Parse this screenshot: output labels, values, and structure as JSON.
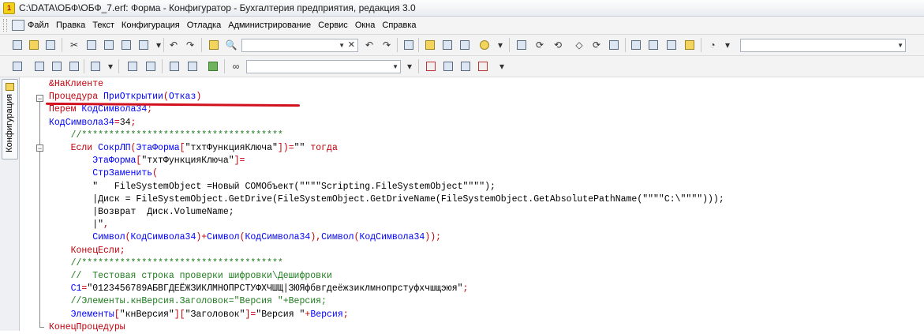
{
  "window": {
    "title": "C:\\DATA\\ОБФ\\ОБФ_7.erf: Форма - Конфигуратор - Бухгалтерия предприятия, редакция 3.0"
  },
  "menu": {
    "items": [
      {
        "label": "Файл"
      },
      {
        "label": "Правка"
      },
      {
        "label": "Текст"
      },
      {
        "label": "Конфигурация"
      },
      {
        "label": "Отладка"
      },
      {
        "label": "Администрирование"
      },
      {
        "label": "Сервис"
      },
      {
        "label": "Окна"
      },
      {
        "label": "Справка"
      }
    ]
  },
  "toolbar": {
    "search_value": "",
    "combo2_value": "",
    "combo3_value": "",
    "combo4_value": ""
  },
  "sidebar": {
    "tab_label": "Конфигурация"
  },
  "code": {
    "lines": [
      [
        {
          "t": "&НаКлиенте",
          "c": "op"
        }
      ],
      [
        {
          "t": "Процедура ",
          "c": "kw"
        },
        {
          "t": "ПриОткрытии",
          "c": "id"
        },
        {
          "t": "(",
          "c": "op"
        },
        {
          "t": "Отказ",
          "c": "id"
        },
        {
          "t": ")",
          "c": "op"
        }
      ],
      [
        {
          "t": "Перем ",
          "c": "kw"
        },
        {
          "t": "КодСимвола34",
          "c": "id"
        },
        {
          "t": ";",
          "c": "op"
        }
      ],
      [
        {
          "t": "КодСимвола34",
          "c": "id"
        },
        {
          "t": "=",
          "c": "op"
        },
        {
          "t": "34",
          "c": "str"
        },
        {
          "t": ";",
          "c": "op"
        }
      ],
      [
        {
          "t": "    //*************************************",
          "c": "cmt"
        }
      ],
      [
        {
          "t": "    Если ",
          "c": "kw"
        },
        {
          "t": "СокрЛП",
          "c": "id"
        },
        {
          "t": "(",
          "c": "op"
        },
        {
          "t": "ЭтаФорма",
          "c": "id"
        },
        {
          "t": "[",
          "c": "op"
        },
        {
          "t": "\"тхтФункцияКлюча\"",
          "c": "str"
        },
        {
          "t": "])=",
          "c": "op"
        },
        {
          "t": "\"\"",
          "c": "str"
        },
        {
          "t": " тогда",
          "c": "kw"
        }
      ],
      [
        {
          "t": "        ЭтаФорма",
          "c": "id"
        },
        {
          "t": "[",
          "c": "op"
        },
        {
          "t": "\"тхтФункцияКлюча\"",
          "c": "str"
        },
        {
          "t": "]=",
          "c": "op"
        }
      ],
      [
        {
          "t": "        СтрЗаменить",
          "c": "id"
        },
        {
          "t": "(",
          "c": "op"
        }
      ],
      [
        {
          "t": "        \"   FileSystemObject =Новый COMОбъект(\"\"\"\"Scripting.FileSystemObject\"\"\"\");",
          "c": "str"
        }
      ],
      [
        {
          "t": "        |Диск = FileSystemObject.GetDrive(FileSystemObject.GetDriveName(FileSystemObject.GetAbsolutePathName(\"\"\"\"C:\\\"\"\"\")));",
          "c": "str"
        }
      ],
      [
        {
          "t": "        |Возврат  Диск.VolumeName;",
          "c": "str"
        }
      ],
      [
        {
          "t": "        |\"",
          "c": "str"
        },
        {
          "t": ",",
          "c": "op"
        }
      ],
      [
        {
          "t": "        Символ",
          "c": "id"
        },
        {
          "t": "(",
          "c": "op"
        },
        {
          "t": "КодСимвола34",
          "c": "id"
        },
        {
          "t": ")+",
          "c": "op"
        },
        {
          "t": "Символ",
          "c": "id"
        },
        {
          "t": "(",
          "c": "op"
        },
        {
          "t": "КодСимвола34",
          "c": "id"
        },
        {
          "t": "),",
          "c": "op"
        },
        {
          "t": "Символ",
          "c": "id"
        },
        {
          "t": "(",
          "c": "op"
        },
        {
          "t": "КодСимвола34",
          "c": "id"
        },
        {
          "t": "));",
          "c": "op"
        }
      ],
      [
        {
          "t": "    КонецЕсли",
          "c": "kw"
        },
        {
          "t": ";",
          "c": "op"
        }
      ],
      [
        {
          "t": "    //*************************************",
          "c": "cmt"
        }
      ],
      [
        {
          "t": "    //  Тестовая строка проверки шифровки\\Дешифровки",
          "c": "cmt"
        }
      ],
      [
        {
          "t": "    С1",
          "c": "id"
        },
        {
          "t": "=",
          "c": "op"
        },
        {
          "t": "\"0123456789АБВГДЕЁЖЗИКЛМНОПРСТУФХЧШЩ|ЗЮЯфбвгдеёжзиклмнопрстуфхчшщэюя\"",
          "c": "str"
        },
        {
          "t": ";",
          "c": "op"
        }
      ],
      [
        {
          "t": "    //Элементы.кнВерсия.Заголовок=\"Версия \"+Версия;",
          "c": "cmt"
        }
      ],
      [
        {
          "t": "    Элементы",
          "c": "id"
        },
        {
          "t": "[",
          "c": "op"
        },
        {
          "t": "\"кнВерсия\"",
          "c": "str"
        },
        {
          "t": "][",
          "c": "op"
        },
        {
          "t": "\"Заголовок\"",
          "c": "str"
        },
        {
          "t": "]=",
          "c": "op"
        },
        {
          "t": "\"Версия \"",
          "c": "str"
        },
        {
          "t": "+",
          "c": "op"
        },
        {
          "t": "Версия",
          "c": "id"
        },
        {
          "t": ";",
          "c": "op"
        }
      ],
      [
        {
          "t": "КонецПроцедуры",
          "c": "kw"
        }
      ]
    ]
  },
  "colors": {
    "keyword": "#c0000b",
    "identifier": "#0000ff",
    "comment": "#1f7c1f",
    "annotation": "#d2111f"
  }
}
